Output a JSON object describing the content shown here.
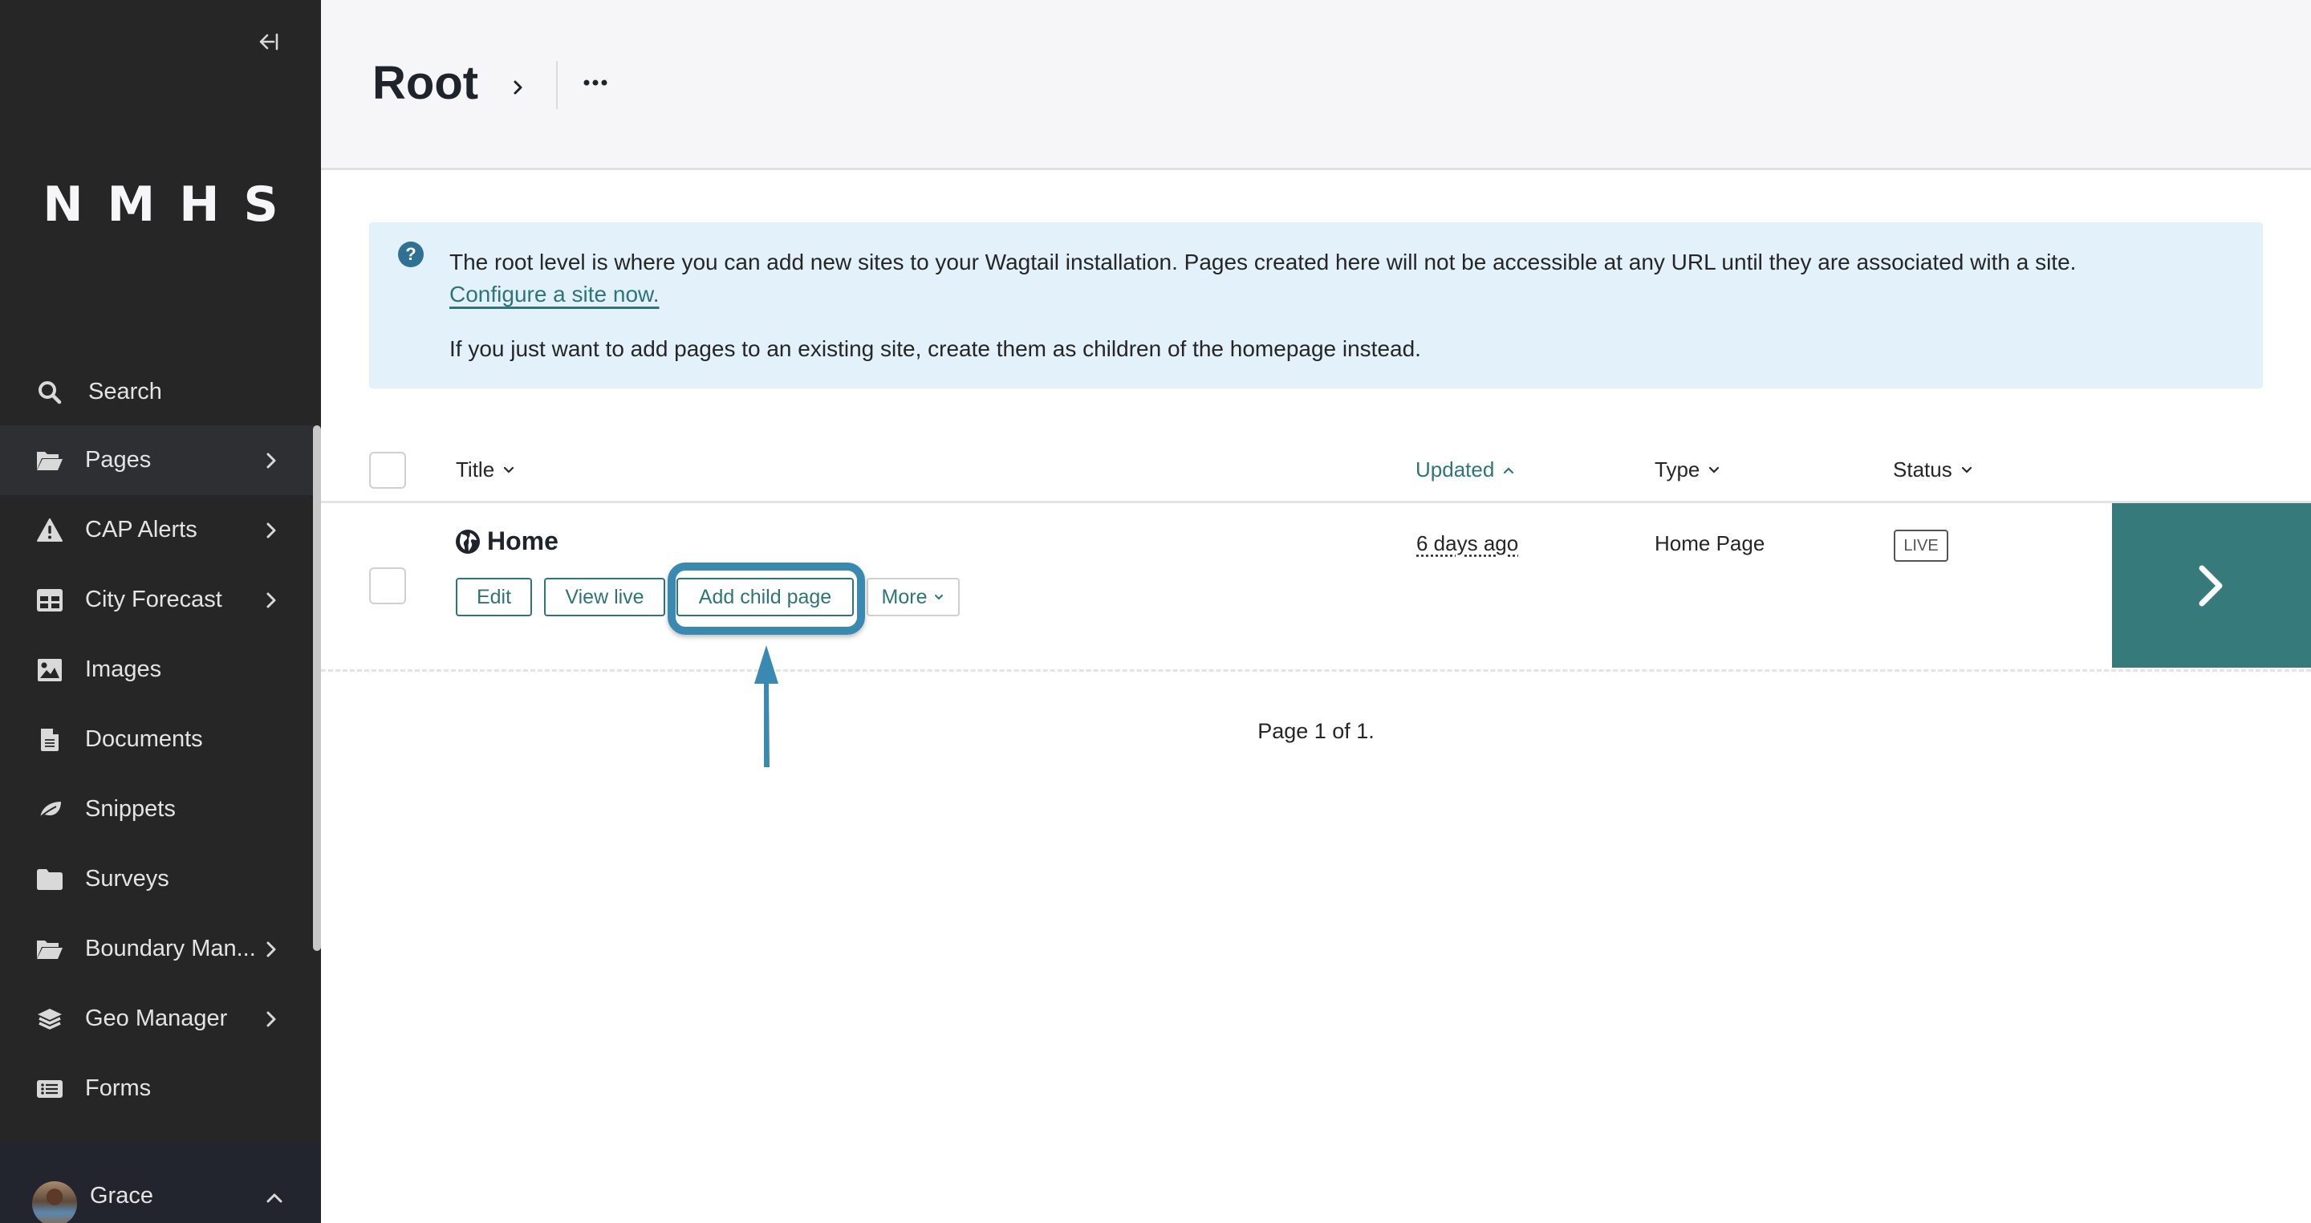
{
  "sidebar": {
    "collapse_icon": "arrow-left-bar-icon",
    "logo": "NMHS",
    "items": [
      {
        "label": "Search",
        "icon": "search-icon",
        "has_submenu": false
      },
      {
        "label": "Pages",
        "icon": "folder-open-icon",
        "has_submenu": true,
        "active": true
      },
      {
        "label": "CAP Alerts",
        "icon": "warning-icon",
        "has_submenu": true
      },
      {
        "label": "City Forecast",
        "icon": "table-icon",
        "has_submenu": true
      },
      {
        "label": "Images",
        "icon": "image-icon",
        "has_submenu": false
      },
      {
        "label": "Documents",
        "icon": "document-icon",
        "has_submenu": false
      },
      {
        "label": "Snippets",
        "icon": "leaf-icon",
        "has_submenu": false
      },
      {
        "label": "Surveys",
        "icon": "folder-icon",
        "has_submenu": false
      },
      {
        "label": "Boundary Man...",
        "icon": "folder-open-icon",
        "has_submenu": true
      },
      {
        "label": "Geo Manager",
        "icon": "layers-icon",
        "has_submenu": true
      },
      {
        "label": "Forms",
        "icon": "list-icon",
        "has_submenu": false
      }
    ],
    "footer": {
      "user_name": "Grace",
      "icon": "chevron-up-icon"
    }
  },
  "header": {
    "title": "Root",
    "more_icon": "ellipsis-icon"
  },
  "info": {
    "text": "The root level is where you can add new sites to your Wagtail installation. Pages created here will not be accessible at any URL until they are associated with a site.",
    "link": "Configure a site now.",
    "text2": "If you just want to add pages to an existing site, create them as children of the homepage instead."
  },
  "table": {
    "columns": [
      {
        "label": "Title",
        "sort": "down"
      },
      {
        "label": "Updated",
        "sort": "up",
        "active": true
      },
      {
        "label": "Type",
        "sort": "down"
      },
      {
        "label": "Status",
        "sort": "down"
      }
    ],
    "rows": [
      {
        "title": "Home",
        "icon": "globe-icon",
        "actions": [
          "Edit",
          "View live",
          "Add child page",
          "More"
        ],
        "updated": "6 days ago",
        "type": "Home Page",
        "status": "LIVE"
      }
    ]
  },
  "pagination": "Page 1 of 1.",
  "colors": {
    "sidebar_bg": "#262626",
    "accent": "#2e7577",
    "explore_bg": "#367a7b",
    "info_bg": "#e2f1fa",
    "annotation": "#3a89b0"
  }
}
